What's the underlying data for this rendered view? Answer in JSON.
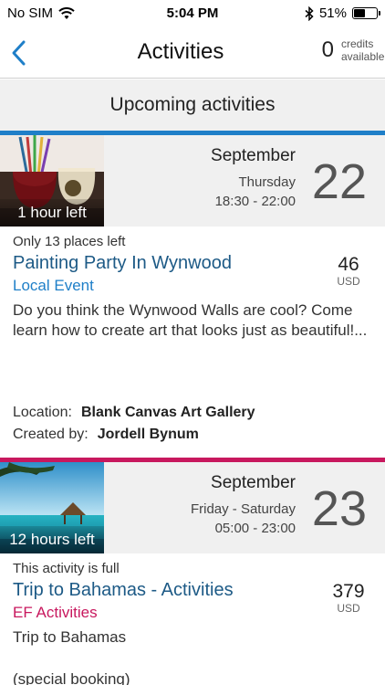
{
  "status_bar": {
    "carrier": "No SIM",
    "time": "5:04 PM",
    "battery_text": "51%",
    "battery_level": 0.51
  },
  "nav": {
    "title": "Activities",
    "credits_count": "0",
    "credits_label_1": "credits",
    "credits_label_2": "available"
  },
  "section_header": "Upcoming activities",
  "activities": [
    {
      "time_left": "1 hour left",
      "month": "September",
      "weekday": "Thursday",
      "hours": "18:30 - 22:00",
      "day": "22",
      "availability": "Only 13 places left",
      "title": "Painting Party In Wynwood",
      "category": "Local Event",
      "category_color": "#1f7fc8",
      "accent_color": "#1f7fc8",
      "price": "46",
      "currency": "USD",
      "description": "Do you think the Wynwood Walls are cool? Come learn how to create art that looks just as beautiful!...",
      "location_label": "Location:",
      "location": "Blank Canvas Art Gallery",
      "created_label": "Created by:",
      "created_by": "Jordell Bynum"
    },
    {
      "time_left": "12 hours left",
      "month": "September",
      "weekday": "Friday - Saturday",
      "hours": "05:00 - 23:00",
      "day": "23",
      "availability": "This activity is full",
      "title": "Trip to Bahamas - Activities",
      "category": "EF Activities",
      "category_color": "#c8185e",
      "accent_color": "#c8185e",
      "price": "379",
      "currency": "USD",
      "description": "Trip to Bahamas",
      "extra": "(special booking)"
    }
  ]
}
